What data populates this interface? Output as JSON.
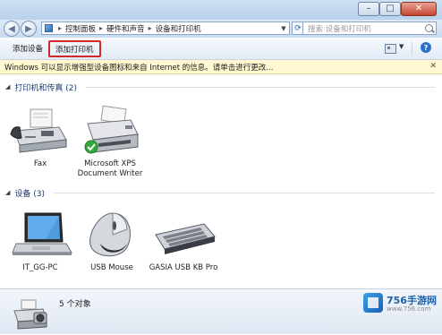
{
  "window": {
    "controls": {
      "minimize": "–",
      "maximize": "□",
      "close": "✕"
    }
  },
  "address_bar": {
    "back_icon": "back-arrow-icon",
    "forward_icon": "forward-arrow-icon",
    "breadcrumbs": [
      "控制面板",
      "硬件和声音",
      "设备和打印机"
    ],
    "search_placeholder": "搜索 设备和打印机"
  },
  "toolbar": {
    "add_device": "添加设备",
    "add_printer": "添加打印机"
  },
  "infobar": {
    "message": "Windows 可以显示增强型设备图标和来自 Internet 的信息。请单击进行更改..."
  },
  "groups": [
    {
      "title": "打印机和传真 (2)",
      "devices": [
        {
          "label": "Fax",
          "icon": "fax-icon"
        },
        {
          "label": "Microsoft XPS Document Writer",
          "icon": "printer-icon",
          "default": true
        }
      ]
    },
    {
      "title": "设备 (3)",
      "devices": [
        {
          "label": "IT_GG-PC",
          "icon": "laptop-icon"
        },
        {
          "label": "USB Mouse",
          "icon": "mouse-icon"
        },
        {
          "label": "GASIA USB KB Pro",
          "icon": "keyboard-icon"
        }
      ]
    }
  ],
  "details": {
    "count": "5 个对象",
    "icon": "printer-camera-icon"
  },
  "watermark": {
    "brand": "756手游网",
    "site": "www.756.com"
  }
}
